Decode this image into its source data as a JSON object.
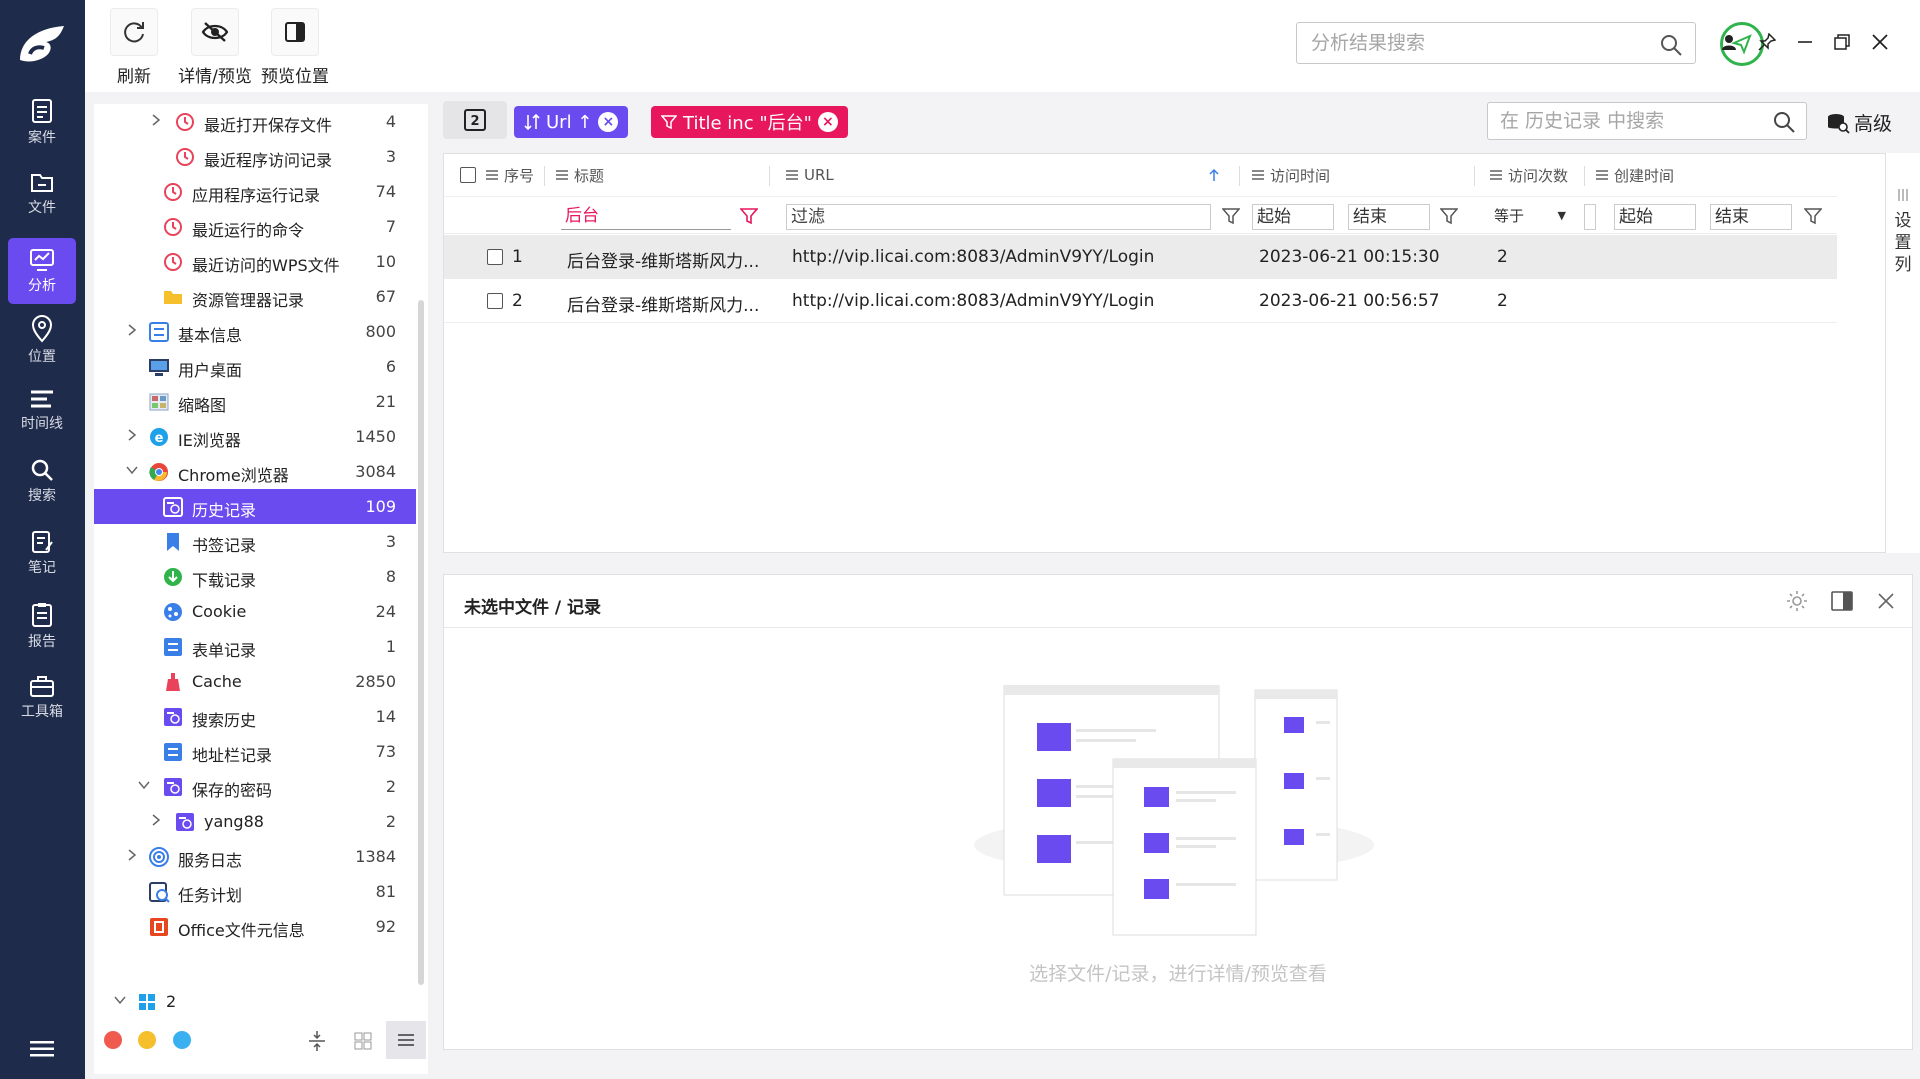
{
  "rail": {
    "items": [
      {
        "label": "案件",
        "icon": "case-icon"
      },
      {
        "label": "文件",
        "icon": "folder-icon"
      },
      {
        "label": "分析",
        "icon": "analysis-icon",
        "active": true
      },
      {
        "label": "位置",
        "icon": "location-icon"
      },
      {
        "label": "时间线",
        "icon": "timeline-icon"
      },
      {
        "label": "搜索",
        "icon": "search-icon"
      },
      {
        "label": "笔记",
        "icon": "note-icon"
      },
      {
        "label": "报告",
        "icon": "report-icon"
      },
      {
        "label": "工具箱",
        "icon": "toolbox-icon"
      }
    ]
  },
  "toolbar": {
    "refresh_label": "刷新",
    "detail_preview_label": "详情/预览",
    "preview_position_label": "预览位置",
    "search_placeholder": "分析结果搜索"
  },
  "tree": {
    "items": [
      {
        "label": "最近打开保存文件",
        "count": "4"
      },
      {
        "label": "最近程序访问记录",
        "count": "3"
      },
      {
        "label": "应用程序运行记录",
        "count": "74"
      },
      {
        "label": "最近运行的命令",
        "count": "7"
      },
      {
        "label": "最近访问的WPS文件",
        "count": "10"
      },
      {
        "label": "资源管理器记录",
        "count": "67"
      },
      {
        "label": "基本信息",
        "count": "800"
      },
      {
        "label": "用户桌面",
        "count": "6"
      },
      {
        "label": "缩略图",
        "count": "21"
      },
      {
        "label": "IE浏览器",
        "count": "1450"
      },
      {
        "label": "Chrome浏览器",
        "count": "3084"
      },
      {
        "label": "历史记录",
        "count": "109"
      },
      {
        "label": "书签记录",
        "count": "3"
      },
      {
        "label": "下载记录",
        "count": "8"
      },
      {
        "label": "Cookie",
        "count": "24"
      },
      {
        "label": "表单记录",
        "count": "1"
      },
      {
        "label": "Cache",
        "count": "2850"
      },
      {
        "label": "搜索历史",
        "count": "14"
      },
      {
        "label": "地址栏记录",
        "count": "73"
      },
      {
        "label": "保存的密码",
        "count": "2"
      },
      {
        "label": "yang88",
        "count": "2"
      },
      {
        "label": "服务日志",
        "count": "1384"
      },
      {
        "label": "任务计划",
        "count": "81"
      },
      {
        "label": "Office文件元信息",
        "count": "92"
      }
    ],
    "root_label": "2",
    "colors": {
      "red": "#f05a4f",
      "yellow": "#f5c02c",
      "blue": "#3ab0f0"
    }
  },
  "grid": {
    "view_count": "2",
    "chips": {
      "sort_label": "Url ↑",
      "filter_label": "Title inc \"后台\""
    },
    "history_search_placeholder": "在 历史记录 中搜索",
    "advanced_label": "高级",
    "columns": [
      "序号",
      "标题",
      "URL",
      "访问时间",
      "访问次数",
      "创建时间"
    ],
    "filters": {
      "title_value": "后台",
      "url_placeholder": "过滤",
      "visit_start": "起始",
      "visit_end": "结束",
      "count_op": "等于",
      "create_start": "起始",
      "create_end": "结束"
    },
    "rows": [
      {
        "index": "1",
        "title": "后台登录-维斯塔斯风力...",
        "url": "http://vip.licai.com:8083/AdminV9YY/Login",
        "time": "2023-06-21 00:15:30",
        "visits": "2"
      },
      {
        "index": "2",
        "title": "后台登录-维斯塔斯风力...",
        "url": "http://vip.licai.com:8083/AdminV9YY/Login",
        "time": "2023-06-21 00:56:57",
        "visits": "2"
      }
    ],
    "settings_label": "设置列",
    "accent": "#6a4bf0",
    "filter_chip_color": "#e8175d"
  },
  "detail": {
    "title": "未选中文件 / 记录",
    "empty_text": "选择文件/记录，进行详情/预览查看"
  }
}
